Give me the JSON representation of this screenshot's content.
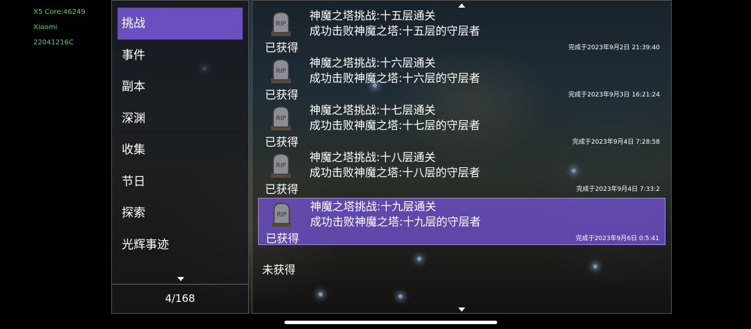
{
  "debug": {
    "core": "X5 Core:46249",
    "brand": "Xiaomi",
    "model": "22041216C"
  },
  "menu": {
    "items": [
      {
        "label": "挑战",
        "active": true
      },
      {
        "label": "事件"
      },
      {
        "label": "副本"
      },
      {
        "label": "深渊"
      },
      {
        "label": "收集"
      },
      {
        "label": "节日"
      },
      {
        "label": "探索"
      },
      {
        "label": "光辉事迹"
      }
    ],
    "page_counter": "4/168"
  },
  "achievements": [
    {
      "title": "神魔之塔挑战:十五层通关",
      "desc": "成功击败神魔之塔:十五层的守层者",
      "status": "已获得",
      "time": "完成于2023年9月2日 21:39:40",
      "icon": "rip-tombstone-icon"
    },
    {
      "title": "神魔之塔挑战:十六层通关",
      "desc": "成功击败神魔之塔:十六层的守层者",
      "status": "已获得",
      "time": "完成于2023年9月3日 16:21:24",
      "icon": "rip-tombstone-icon"
    },
    {
      "title": "神魔之塔挑战:十七层通关",
      "desc": "成功击败神魔之塔:十七层的守层者",
      "status": "已获得",
      "time": "完成于2023年9月4日 7:28:58",
      "icon": "rip-tombstone-icon"
    },
    {
      "title": "神魔之塔挑战:十八层通关",
      "desc": "成功击败神魔之塔:十八层的守层者",
      "status": "已获得",
      "time": "完成于2023年9月4日 7:33:2",
      "icon": "rip-tombstone-icon"
    },
    {
      "title": "神魔之塔挑战:十九层通关",
      "desc": "成功击败神魔之塔:十九层的守层者",
      "status": "已获得",
      "time": "完成于2023年9月6日 0:5:41",
      "icon": "rip-tombstone-icon",
      "highlighted": true
    }
  ],
  "unobtained_label": "未获得",
  "colors": {
    "accent": "#6a4fc0",
    "highlight": "#6e50c8",
    "debug_text": "#4cd964"
  }
}
